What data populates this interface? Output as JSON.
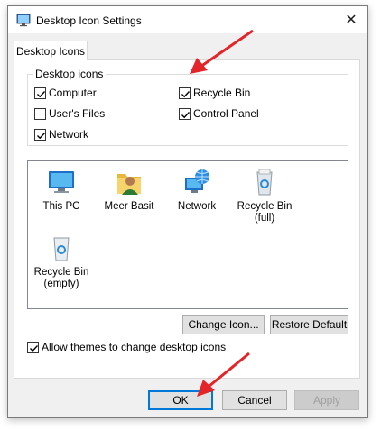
{
  "window": {
    "title": "Desktop Icon Settings",
    "close_glyph": "✕"
  },
  "tab": {
    "label": "Desktop Icons"
  },
  "desktop_icons_group": {
    "legend": "Desktop icons",
    "items": [
      {
        "label": "Computer",
        "checked": true
      },
      {
        "label": "Recycle Bin",
        "checked": true
      },
      {
        "label": "User's Files",
        "checked": false
      },
      {
        "label": "Control Panel",
        "checked": true
      },
      {
        "label": "Network",
        "checked": true
      }
    ]
  },
  "icon_list": [
    {
      "label": "This PC",
      "icon": "monitor-icon"
    },
    {
      "label": "Meer Basit",
      "icon": "user-folder-icon"
    },
    {
      "label": "Network",
      "icon": "network-globe-icon"
    },
    {
      "label": "Recycle Bin\n(full)",
      "icon": "recycle-bin-full-icon"
    },
    {
      "label": "Recycle Bin\n(empty)",
      "icon": "recycle-bin-empty-icon"
    }
  ],
  "buttons": {
    "change_icon": "Change Icon...",
    "restore_default": "Restore Default",
    "ok": "OK",
    "cancel": "Cancel",
    "apply": "Apply"
  },
  "allow_themes": {
    "label": "Allow themes to change desktop icons",
    "checked": true
  },
  "colors": {
    "arrow": "#e3252a",
    "focus": "#0078d7"
  }
}
